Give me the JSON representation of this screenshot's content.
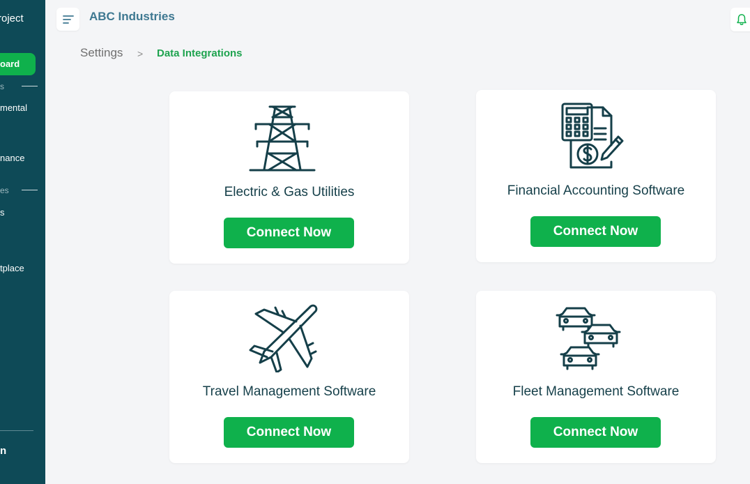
{
  "sidebar": {
    "brand": "roject",
    "active_item": "oard",
    "section1": "s",
    "item1": "mental",
    "item2": "nance",
    "section2": "es",
    "item3": "s",
    "item4": "tplace",
    "bottom": "n"
  },
  "header": {
    "company": "ABC Industries"
  },
  "breadcrumb": {
    "parent": "Settings",
    "separator": ">",
    "current": "Data Integrations"
  },
  "colors": {
    "sidebar_bg": "#0e4a57",
    "accent_green": "#0fb14c",
    "icon_stroke": "#153f49",
    "company_blue": "#3e7891"
  },
  "cards": [
    {
      "icon": "power-tower-icon",
      "title": "Electric & Gas Utilities",
      "button": "Connect Now"
    },
    {
      "icon": "calculator-invoice-icon",
      "title": "Financial Accounting Software",
      "button": "Connect Now"
    },
    {
      "icon": "airplane-icon",
      "title": "Travel Management Software",
      "button": "Connect Now"
    },
    {
      "icon": "cars-fleet-icon",
      "title": "Fleet Management Software",
      "button": "Connect Now"
    }
  ]
}
